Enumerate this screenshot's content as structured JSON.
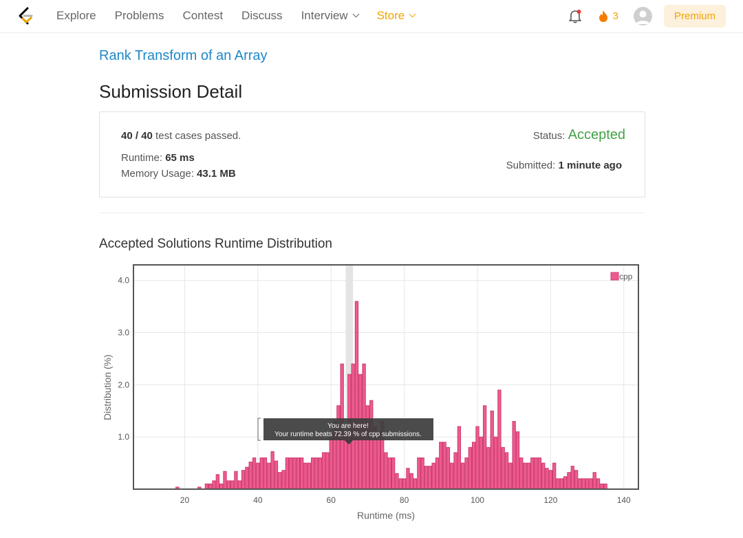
{
  "nav": {
    "links": [
      "Explore",
      "Problems",
      "Contest",
      "Discuss",
      "Interview",
      "Store"
    ],
    "streak": "3",
    "premium": "Premium"
  },
  "problem_title": "Rank Transform of an Array",
  "page_title": "Submission Detail",
  "detail": {
    "cases_passed": "40",
    "cases_sep": " / ",
    "cases_total": "40",
    "cases_suffix": " test cases passed.",
    "runtime_label": "Runtime: ",
    "runtime_value": "65 ms",
    "memory_label": "Memory Usage: ",
    "memory_value": "43.1 MB",
    "status_label": "Status: ",
    "status_value": "Accepted",
    "submitted_label": "Submitted: ",
    "submitted_value": "1 minute ago"
  },
  "colors": {
    "accent": "#1e88c8",
    "store": "#f0a500",
    "accepted": "#43a047",
    "bar": "#ee5b8f"
  },
  "chart_title": "Accepted Solutions Runtime Distribution",
  "chart_data": {
    "type": "bar",
    "series": [
      {
        "name": "cpp",
        "x": [
          18,
          24,
          26,
          27,
          28,
          29,
          30,
          31,
          32,
          33,
          34,
          35,
          36,
          37,
          38,
          39,
          40,
          41,
          42,
          43,
          44,
          45,
          46,
          47,
          48,
          49,
          50,
          51,
          52,
          53,
          54,
          55,
          56,
          57,
          58,
          59,
          60,
          61,
          62,
          63,
          64,
          65,
          66,
          67,
          68,
          69,
          70,
          71,
          72,
          73,
          74,
          75,
          76,
          77,
          78,
          79,
          80,
          81,
          82,
          83,
          84,
          85,
          86,
          87,
          88,
          89,
          90,
          91,
          92,
          93,
          94,
          95,
          96,
          97,
          98,
          99,
          100,
          101,
          102,
          103,
          104,
          105,
          106,
          107,
          108,
          109,
          110,
          111,
          112,
          113,
          114,
          115,
          116,
          117,
          118,
          119,
          120,
          121,
          122,
          123,
          124,
          125,
          126,
          127,
          128,
          129,
          130,
          131,
          132,
          133,
          134,
          135
        ],
        "values": [
          0.04,
          0.04,
          0.1,
          0.1,
          0.16,
          0.28,
          0.1,
          0.34,
          0.16,
          0.16,
          0.34,
          0.16,
          0.36,
          0.42,
          0.52,
          0.6,
          0.5,
          0.6,
          0.6,
          0.5,
          0.72,
          0.54,
          0.32,
          0.36,
          0.6,
          0.6,
          0.6,
          0.6,
          0.6,
          0.5,
          0.5,
          0.6,
          0.6,
          0.6,
          0.7,
          0.7,
          1.0,
          1.3,
          1.6,
          2.4,
          1.1,
          2.2,
          2.4,
          3.6,
          2.2,
          2.4,
          1.6,
          1.7,
          1.2,
          1.1,
          1.3,
          0.7,
          0.6,
          0.6,
          0.3,
          0.2,
          0.2,
          0.4,
          0.3,
          0.2,
          0.6,
          0.6,
          0.44,
          0.44,
          0.5,
          0.6,
          0.9,
          0.9,
          0.8,
          0.5,
          0.7,
          1.2,
          0.5,
          0.6,
          0.8,
          0.9,
          1.2,
          1.0,
          1.6,
          0.8,
          1.5,
          1.0,
          1.9,
          0.8,
          0.7,
          0.5,
          1.3,
          1.1,
          0.6,
          0.5,
          0.5,
          0.6,
          0.6,
          0.6,
          0.5,
          0.4,
          0.36,
          0.5,
          0.2,
          0.2,
          0.24,
          0.32,
          0.44,
          0.36,
          0.2,
          0.2,
          0.2,
          0.2,
          0.32,
          0.2,
          0.1,
          0.1
        ]
      }
    ],
    "xlabel": "Runtime (ms)",
    "ylabel": "Distribution (%)",
    "xlim": [
      6,
      144
    ],
    "ylim": [
      0,
      4.3
    ],
    "x_ticks": [
      20,
      40,
      60,
      80,
      100,
      120,
      140
    ],
    "y_ticks": [
      1.0,
      2.0,
      3.0,
      4.0
    ],
    "grid": true,
    "legend_position": "top-right",
    "highlight_x": 65,
    "tooltip_line1": "You are here!",
    "tooltip_line2": "Your runtime beats 72.39 % of cpp submissions."
  }
}
